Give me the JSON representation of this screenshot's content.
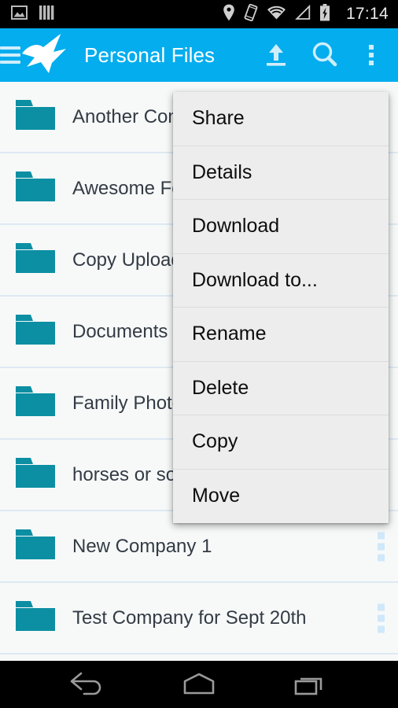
{
  "status_bar": {
    "time": "17:14",
    "left_icons": [
      {
        "name": "photo-icon"
      },
      {
        "name": "bars-icon"
      }
    ],
    "right_icons": [
      {
        "name": "location-pin-icon"
      },
      {
        "name": "vibrate-icon"
      },
      {
        "name": "wifi-icon"
      },
      {
        "name": "cell-signal-icon"
      },
      {
        "name": "battery-charging-icon"
      }
    ]
  },
  "app_bar": {
    "title": "Personal Files",
    "menu_icon": "hamburger-icon",
    "logo_icon": "origami-crane-logo",
    "actions": [
      {
        "name": "upload-icon",
        "label": "Upload"
      },
      {
        "name": "search-icon",
        "label": "Search"
      },
      {
        "name": "overflow-menu-icon",
        "label": "More options"
      }
    ],
    "background_color": "#03ADEE",
    "title_color": "#FFFFFF"
  },
  "file_list": {
    "folder_icon": "folder-icon",
    "row_menu_icon": "row-overflow-icon",
    "folder_color": "#0C8FA3",
    "divider_color": "#DDE9F3",
    "items": [
      {
        "label": "Another Com"
      },
      {
        "label": "Awesome Fo"
      },
      {
        "label": "Copy Upload"
      },
      {
        "label": "Documents"
      },
      {
        "label": "Family Photo"
      },
      {
        "label": "horses or so"
      },
      {
        "label": "New Company 1"
      },
      {
        "label": "Test Company for Sept 20th"
      }
    ]
  },
  "context_menu": {
    "background_color": "#EDEDED",
    "items": [
      {
        "label": "Share"
      },
      {
        "label": "Details"
      },
      {
        "label": "Download"
      },
      {
        "label": "Download to..."
      },
      {
        "label": "Rename"
      },
      {
        "label": "Delete"
      },
      {
        "label": "Copy"
      },
      {
        "label": "Move"
      }
    ]
  },
  "nav_bar": {
    "buttons": [
      {
        "name": "back-button"
      },
      {
        "name": "home-button"
      },
      {
        "name": "recents-button"
      }
    ]
  }
}
